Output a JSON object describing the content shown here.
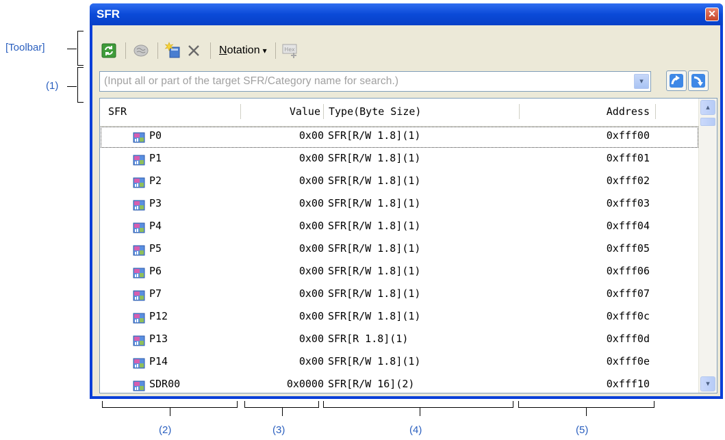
{
  "callouts": {
    "toolbar": "[Toolbar]",
    "search": "(1)",
    "col_sfr": "(2)",
    "col_value": "(3)",
    "col_type": "(4)",
    "col_address": "(5)"
  },
  "window": {
    "title": "SFR",
    "close_glyph": "✕"
  },
  "toolbar": {
    "buttons": [
      {
        "name": "refresh",
        "icon": "refresh-icon"
      },
      {
        "name": "view-lookup",
        "icon": "brain-icon"
      },
      {
        "name": "new-category",
        "icon": "new-category-icon"
      },
      {
        "name": "delete",
        "icon": "delete-icon"
      }
    ],
    "notation_label": "Notation",
    "notation_accel": "N",
    "notation_rest": "otation",
    "notation_arrow": "▾",
    "hex_label": "Hex"
  },
  "search": {
    "placeholder": "(Input all or part of the target SFR/Category name for search.)",
    "dropdown_glyph": "▾"
  },
  "grid": {
    "headers": {
      "sfr": "SFR",
      "value": "Value",
      "type": "Type(Byte Size)",
      "address": "Address"
    },
    "rows": [
      {
        "name": "P0",
        "value": "0x00",
        "type": "SFR[R/W 1.8](1)",
        "address": "0xfff00",
        "selected": true
      },
      {
        "name": "P1",
        "value": "0x00",
        "type": "SFR[R/W 1.8](1)",
        "address": "0xfff01"
      },
      {
        "name": "P2",
        "value": "0x00",
        "type": "SFR[R/W 1.8](1)",
        "address": "0xfff02"
      },
      {
        "name": "P3",
        "value": "0x00",
        "type": "SFR[R/W 1.8](1)",
        "address": "0xfff03"
      },
      {
        "name": "P4",
        "value": "0x00",
        "type": "SFR[R/W 1.8](1)",
        "address": "0xfff04"
      },
      {
        "name": "P5",
        "value": "0x00",
        "type": "SFR[R/W 1.8](1)",
        "address": "0xfff05"
      },
      {
        "name": "P6",
        "value": "0x00",
        "type": "SFR[R/W 1.8](1)",
        "address": "0xfff06"
      },
      {
        "name": "P7",
        "value": "0x00",
        "type": "SFR[R/W 1.8](1)",
        "address": "0xfff07"
      },
      {
        "name": "P12",
        "value": "0x00",
        "type": "SFR[R/W 1.8](1)",
        "address": "0xfff0c"
      },
      {
        "name": "P13",
        "value": "0x00",
        "type": "SFR[R 1.8](1)",
        "address": "0xfff0d"
      },
      {
        "name": "P14",
        "value": "0x00",
        "type": "SFR[R/W 1.8](1)",
        "address": "0xfff0e"
      },
      {
        "name": "SDR00",
        "value": "0x0000",
        "type": "SFR[R/W 16](2)",
        "address": "0xfff10"
      }
    ]
  },
  "scrollbar": {
    "up_glyph": "▴",
    "down_glyph": "▾"
  },
  "colors": {
    "accent": "#0a3fd8",
    "callout": "#2a5fbf",
    "client_bg": "#ece9d8"
  }
}
